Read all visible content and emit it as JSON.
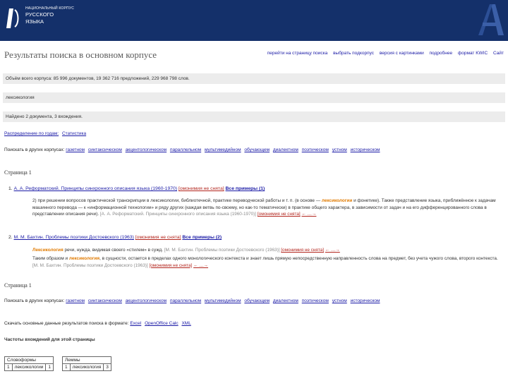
{
  "header": {
    "brand_small": "НАЦИОНАЛЬНЫЙ КОРПУС",
    "brand_line1": "РУССКОГО",
    "brand_line2": "ЯЗЫКА"
  },
  "page_title": "Результаты поиска в основном корпусе",
  "toplinks": [
    "перейти на страницу поиска",
    "выбрать подкорпус",
    "версия с картинками",
    "подробнее",
    "формат KWIC",
    "Сайт"
  ],
  "summary_bar": "Объём всего корпуса: 85 996 документов, 19 362 716 предложений, 229 968 798 слов.",
  "query_bar": "лексикология",
  "found_bar": "Найдено 2 документа, 3 вхождения.",
  "distribution": {
    "label": "Распределение по годам:",
    "stats_link": "Статистика"
  },
  "other_corpora": {
    "label": "Поискать в других корпусах:",
    "links": [
      "газетном",
      "синтаксическом",
      "акцентологическом",
      "параллельном",
      "мультимедийном",
      "обучающем",
      "диалектном",
      "поэтическом",
      "устном",
      "историческом"
    ]
  },
  "page_label": "Страница 1",
  "docs": [
    {
      "number": "1.",
      "title": "А. А. Реформатский. Принципы синхронного описания языка (1960-1970)",
      "context_link": "[омонимия не снята]",
      "examples_link": "Все примеры (1)",
      "snippet_pre": "2) при решении вопросов практической транскрипции в лексикологии, библиотечной, практике переводческой работы и т. п. (в основе —",
      "snippet_hl": "лексикологии",
      "snippet_post": "и фонетике). Также представление языка, приближённое к задачам машинного перевода — к «информационной технологии» и ряду других (каждая ветвь по-своему, но как-то тематически) в практике общего характера, в зависимости от задач и на его дифференцированного слова в представлении описания речи).",
      "source": "[А. А. Реформатский. Принципы синхронного описания языка (1960-1970)]",
      "context_after": "[омонимия не снята]",
      "ellipsis": "← …→"
    },
    {
      "number": "2.",
      "title": "М. М. Бахтин. Проблемы поэтики Достоевского (1963)",
      "context_link": "[омонимия не снята]",
      "examples_link": "Все примеры (2)",
      "ex1_hl": "Лексикология",
      "ex1_text": "речи, нужда, видимая своего «стилем» в сужд.",
      "ex1_source": "[М. М. Бахтин. Проблемы поэтики Достоевского (1963)]",
      "ex1_context": "[омонимия не снята]",
      "ex1_ellipsis": "← …→",
      "ex2_pre": "Таким образом и",
      "ex2_hl": "лексикология",
      "ex2_post": ", в сущности, остается в пределах одного монологического контекста и знает лишь прямую непосредственную направленность слова на предмет, без учета чужого слова, второго контекста.",
      "ex2_source": "[М. М. Бахтин. Проблемы поэтики Достоевского (1963)]",
      "ex2_context": "[омонимия не снята]",
      "ex2_ellipsis": "← …→"
    }
  ],
  "export": {
    "label": "Скачать основные данные результатов поиска в формате:",
    "formats": [
      "Excel",
      "OpenOffice Calc",
      "XML"
    ]
  },
  "freq_title": "Частоты вхождений для этой страницы",
  "freq_tables": [
    {
      "header": "Словоформы",
      "rows": [
        {
          "n": "1",
          "word": "лексикологии",
          "count": "1"
        }
      ]
    },
    {
      "header": "Леммы",
      "rows": [
        {
          "n": "1",
          "word": "лексикология",
          "count": "3"
        }
      ]
    }
  ],
  "colors": {
    "header_bg": "#14306a",
    "link": "#1a1aa6",
    "highlight": "#e07a00",
    "context_red": "#b3261e",
    "bar_bg": "#ececec"
  }
}
